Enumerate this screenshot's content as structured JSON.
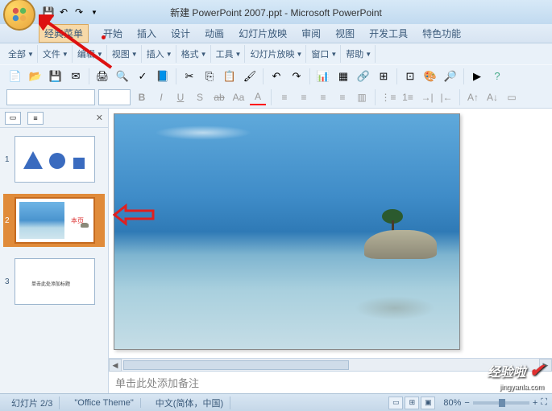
{
  "title": "新建 PowerPoint 2007.ppt - Microsoft PowerPoint",
  "menu": [
    "经典菜单",
    "开始",
    "插入",
    "设计",
    "动画",
    "幻灯片放映",
    "审阅",
    "视图",
    "开发工具",
    "特色功能"
  ],
  "toolbar_dropdowns": [
    "全部",
    "文件",
    "编辑",
    "视图",
    "插入",
    "格式",
    "工具",
    "幻灯片放映",
    "窗口",
    "帮助"
  ],
  "font_placeholder": "",
  "notes_placeholder": "单击此处添加备注",
  "slides": [
    {
      "num": "1",
      "type": "shapes"
    },
    {
      "num": "2",
      "type": "photo",
      "mark": "本页"
    },
    {
      "num": "3",
      "type": "text",
      "text": "单击此处添加标题"
    }
  ],
  "status": {
    "slide_indicator": "幻灯片 2/3",
    "theme": "\"Office Theme\"",
    "lang": "中文(简体，中国)",
    "zoom": "80%"
  },
  "watermark": "经验啦",
  "watermark_url": "jingyanla.com"
}
